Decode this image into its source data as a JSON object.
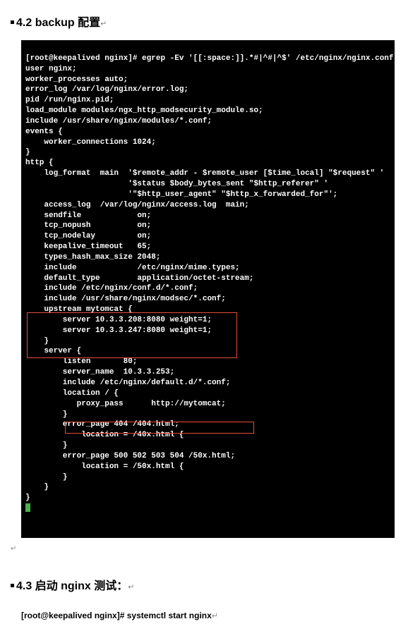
{
  "headings": {
    "h42": "4.2 backup 配置",
    "h43": "4.3  启动 nginx 测试："
  },
  "return_marker": "↵",
  "terminal": {
    "prompt_user": "[root@keepalived nginx]#",
    "cmd": "egrep -Ev '[[:space:]].*#|^#|^$' /etc/nginx/nginx.conf",
    "lines": {
      "l01": "user nginx;",
      "l02": "worker_processes auto;",
      "l03": "error_log /var/log/nginx/error.log;",
      "l04": "pid /run/nginx.pid;",
      "l05": "load_module modules/ngx_http_modsecurity_module.so;",
      "l06": "include /usr/share/nginx/modules/*.conf;",
      "l07": "events {",
      "l08": "    worker_connections 1024;",
      "l09": "}",
      "l10": "http {",
      "l11": "    log_format  main  '$remote_addr - $remote_user [$time_local] \"$request\" '",
      "l12": "                      '$status $body_bytes_sent \"$http_referer\" '",
      "l13": "                      '\"$http_user_agent\" \"$http_x_forwarded_for\"';",
      "l14": "    access_log  /var/log/nginx/access.log  main;",
      "l15": "    sendfile            on;",
      "l16": "    tcp_nopush          on;",
      "l17": "    tcp_nodelay         on;",
      "l18": "    keepalive_timeout   65;",
      "l19": "    types_hash_max_size 2048;",
      "l20": "    include             /etc/nginx/mime.types;",
      "l21": "    default_type        application/octet-stream;",
      "l22": "    include /etc/nginx/conf.d/*.conf;",
      "l23": "    include /usr/share/nginx/modsec/*.conf;",
      "l24": "    upstream mytomcat {",
      "l25": "        server 10.3.3.208:8080 weight=1;",
      "l26": "        server 10.3.3.247:8080 weight=1;",
      "l27": "    }",
      "l28": "    server {",
      "l29": "        listen       80;",
      "l30": "        server_name  10.3.3.253;",
      "l31": "        include /etc/nginx/default.d/*.conf;",
      "l32": "        location / {",
      "l33": "           proxy_pass      http://mytomcat;",
      "l34": "        }",
      "l35": "        error_page 404 /404.html;",
      "l36": "            location = /40x.html {",
      "l37": "        }",
      "l38": "        error_page 500 502 503 504 /50x.html;",
      "l39": "            location = /50x.html {",
      "l40": "        }",
      "l41": "    }",
      "l42": "}"
    }
  },
  "command": {
    "prompt": "[root@keepalived nginx]#",
    "text": "systemctl start nginx"
  }
}
